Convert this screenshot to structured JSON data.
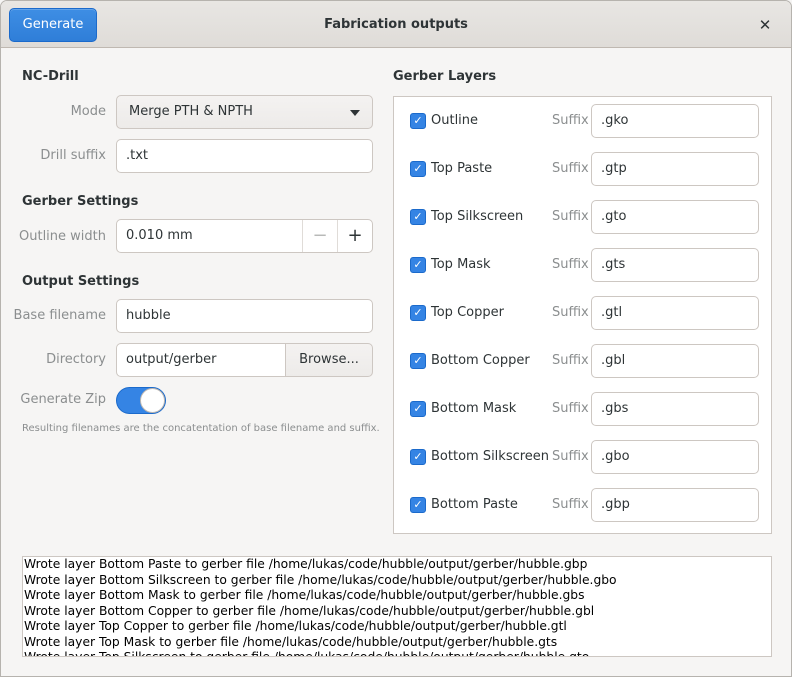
{
  "window": {
    "title": "Fabrication outputs",
    "generate_label": "Generate",
    "close_glyph": "✕"
  },
  "nc_drill": {
    "title": "NC-Drill",
    "mode_label": "Mode",
    "mode_value": "Merge PTH & NPTH",
    "drill_suffix_label": "Drill suffix",
    "drill_suffix_value": ".txt"
  },
  "gerber_settings": {
    "title": "Gerber Settings",
    "outline_width_label": "Outline width",
    "outline_width_value": "0.010 mm",
    "minus": "−",
    "plus": "+"
  },
  "output_settings": {
    "title": "Output Settings",
    "base_filename_label": "Base filename",
    "base_filename_value": "hubble",
    "directory_label": "Directory",
    "directory_value": "output/gerber",
    "browse_label": "Browse...",
    "generate_zip_label": "Generate Zip",
    "generate_zip_on": true,
    "hint": "Resulting filenames are the concatentation of base filename and suffix."
  },
  "gerber_layers": {
    "title": "Gerber Layers",
    "suffix_label": "Suffix",
    "check_glyph": "✓",
    "layers": [
      {
        "name": "Outline",
        "checked": true,
        "suffix": ".gko"
      },
      {
        "name": "Top Paste",
        "checked": true,
        "suffix": ".gtp"
      },
      {
        "name": "Top Silkscreen",
        "checked": true,
        "suffix": ".gto"
      },
      {
        "name": "Top Mask",
        "checked": true,
        "suffix": ".gts"
      },
      {
        "name": "Top Copper",
        "checked": true,
        "suffix": ".gtl"
      },
      {
        "name": "Bottom Copper",
        "checked": true,
        "suffix": ".gbl"
      },
      {
        "name": "Bottom Mask",
        "checked": true,
        "suffix": ".gbs"
      },
      {
        "name": "Bottom Silkscreen",
        "checked": true,
        "suffix": ".gbo"
      },
      {
        "name": "Bottom Paste",
        "checked": true,
        "suffix": ".gbp"
      }
    ]
  },
  "log": {
    "lines": [
      "Wrote layer Bottom Paste to gerber file /home/lukas/code/hubble/output/gerber/hubble.gbp",
      "Wrote layer Bottom Silkscreen to gerber file /home/lukas/code/hubble/output/gerber/hubble.gbo",
      "Wrote layer Bottom Mask to gerber file /home/lukas/code/hubble/output/gerber/hubble.gbs",
      "Wrote layer Bottom Copper to gerber file /home/lukas/code/hubble/output/gerber/hubble.gbl",
      "Wrote layer Top Copper to gerber file /home/lukas/code/hubble/output/gerber/hubble.gtl",
      "Wrote layer Top Mask to gerber file /home/lukas/code/hubble/output/gerber/hubble.gts",
      "Wrote layer Top Silkscreen to gerber file /home/lukas/code/hubble/output/gerber/hubble.gto"
    ]
  }
}
